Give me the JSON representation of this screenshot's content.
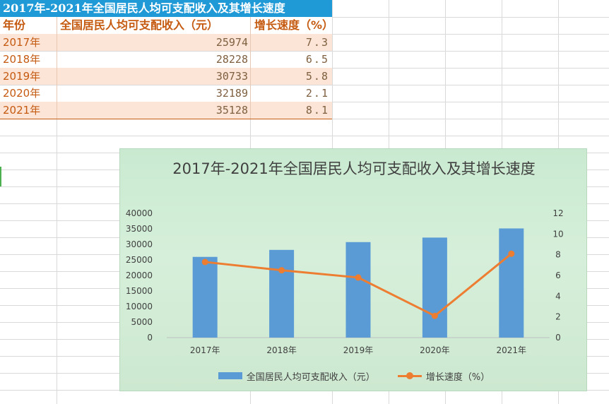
{
  "sheet": {
    "title": "2017年-2021年全国居民人均可支配收入及其增长速度",
    "headers": {
      "year": "年份",
      "income": "全国居民人均可支配收入（元）",
      "rate": "增长速度（%）"
    },
    "rows": [
      {
        "year": "2017年",
        "income": "25974",
        "rate": "7.3"
      },
      {
        "year": "2018年",
        "income": "28228",
        "rate": "6.5"
      },
      {
        "year": "2019年",
        "income": "30733",
        "rate": "5.8"
      },
      {
        "year": "2020年",
        "income": "32189",
        "rate": "2.1"
      },
      {
        "year": "2021年",
        "income": "35128",
        "rate": "8.1"
      }
    ]
  },
  "colors": {
    "title_fill": "#1f9ad6",
    "header_text": "#c55a11",
    "row_shade": "#fce4d6",
    "bar": "#5b9bd5",
    "line": "#ed7d31"
  },
  "chart_data": {
    "type": "bar",
    "title": "2017年-2021年全国居民人均可支配收入及其增长速度",
    "categories": [
      "2017年",
      "2018年",
      "2019年",
      "2020年",
      "2021年"
    ],
    "series": [
      {
        "name": "全国居民人均可支配收入（元）",
        "type": "bar",
        "axis": "left",
        "values": [
          25974,
          28228,
          30733,
          32189,
          35128
        ]
      },
      {
        "name": "增长速度（%）",
        "type": "line",
        "axis": "right",
        "values": [
          7.3,
          6.5,
          5.8,
          2.1,
          8.1
        ]
      }
    ],
    "y_left": {
      "min": 0,
      "max": 40000,
      "step": 5000,
      "ticks": [
        "0",
        "5000",
        "10000",
        "15000",
        "20000",
        "25000",
        "30000",
        "35000",
        "40000"
      ]
    },
    "y_right": {
      "min": 0,
      "max": 12,
      "step": 2,
      "ticks": [
        "0",
        "2",
        "4",
        "6",
        "8",
        "10",
        "12"
      ]
    },
    "grid": false,
    "legend": "bottom"
  }
}
